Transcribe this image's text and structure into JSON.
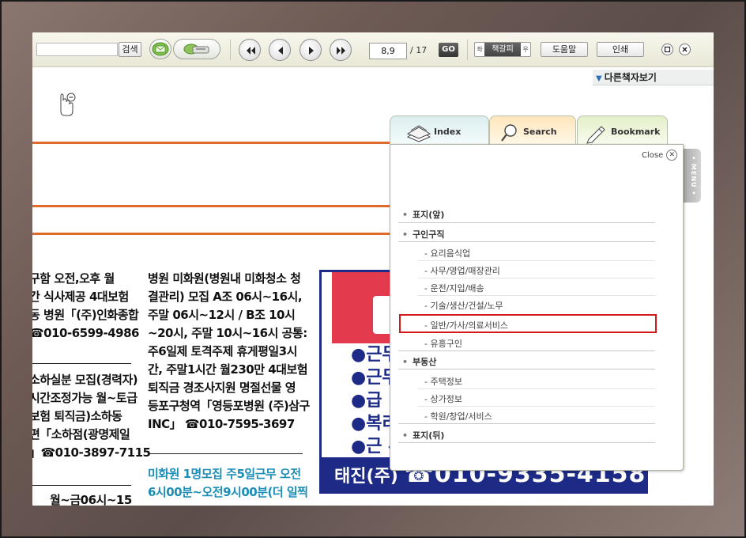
{
  "toolbar": {
    "search_button": "검색",
    "page_current": "8,9",
    "page_total": "/ 17",
    "go_label": "GO",
    "view_mode_label": "책갈피",
    "view_prev": "좌",
    "view_next": "우",
    "help_label": "도움말",
    "print_label": "인쇄",
    "icons": [
      "back-first-icon",
      "prev-icon",
      "next-icon",
      "forward-last-icon",
      "email-icon",
      "cd-icon",
      "restore-icon",
      "close-icon"
    ]
  },
  "other_books": {
    "label": "다른책자보기"
  },
  "newspaper": {
    "col1": [
      "구함 오전,오후 월",
      "간 식사제공 4대보험",
      "동 병원「(주)인화종합",
      "☎010-6599-4986",
      "소하실분 모집(경력자)",
      "시간조정가능 월~토급",
      "보험 퇴직금)소하동",
      "편「소하점(광명제일",
      "」☎010-3897-7115",
      "월~금06시~15"
    ],
    "col2": [
      "병원 미화원(병원내 미화청소 청",
      "결관리) 모집 A조 06시~16시,",
      "주말 06시~12시 / B조 10시",
      "~20시, 주말 10시~16시 공통:",
      "주6일제 토격주제  휴게평일3시",
      "간, 주말1시간 월230만 4대보험",
      "퇴직금 경조사지원 명절선물 영",
      "등포구청역「영등포병원 (주)삼구",
      "INC」      ☎010-7595-3697"
    ],
    "col2_blue": [
      "미화원 1명모집 주5일근무 오전",
      "6시00분~오전9시00분(더 일찍"
    ],
    "ad_bullets": [
      "●근무",
      "●근무",
      "●급",
      "●복리",
      "●근 무"
    ],
    "ad_footer_name": "태진(주)",
    "ad_footer_phone": "☎010-9335-4158"
  },
  "panel": {
    "tabs": {
      "index": "Index",
      "search": "Search",
      "bookmark": "Bookmark"
    },
    "close_label": "Close",
    "menu_label": "• MENU •",
    "items": {
      "cover_front": "표지(앞)",
      "job_wanted": "구인구직",
      "sub_food": "- 요리음식업",
      "sub_office": "- 사무/영업/매장관리",
      "sub_driving": "- 운전/지입/배송",
      "sub_tech": "- 기술/생산/건설/노무",
      "sub_general": "- 일반/가사/의료서비스",
      "sub_entertain": "- 유흥구인",
      "real_estate": "부동산",
      "sub_housing": "- 주택정보",
      "sub_shop": "- 상가정보",
      "sub_academy": "- 학원/창업/서비스",
      "cover_back": "표지(뒤)"
    }
  },
  "colors": {
    "accent_orange": "#e06a2a",
    "ad_navy": "#1d2a86",
    "ad_red": "#e33a4d",
    "highlight": "#d3191c"
  }
}
